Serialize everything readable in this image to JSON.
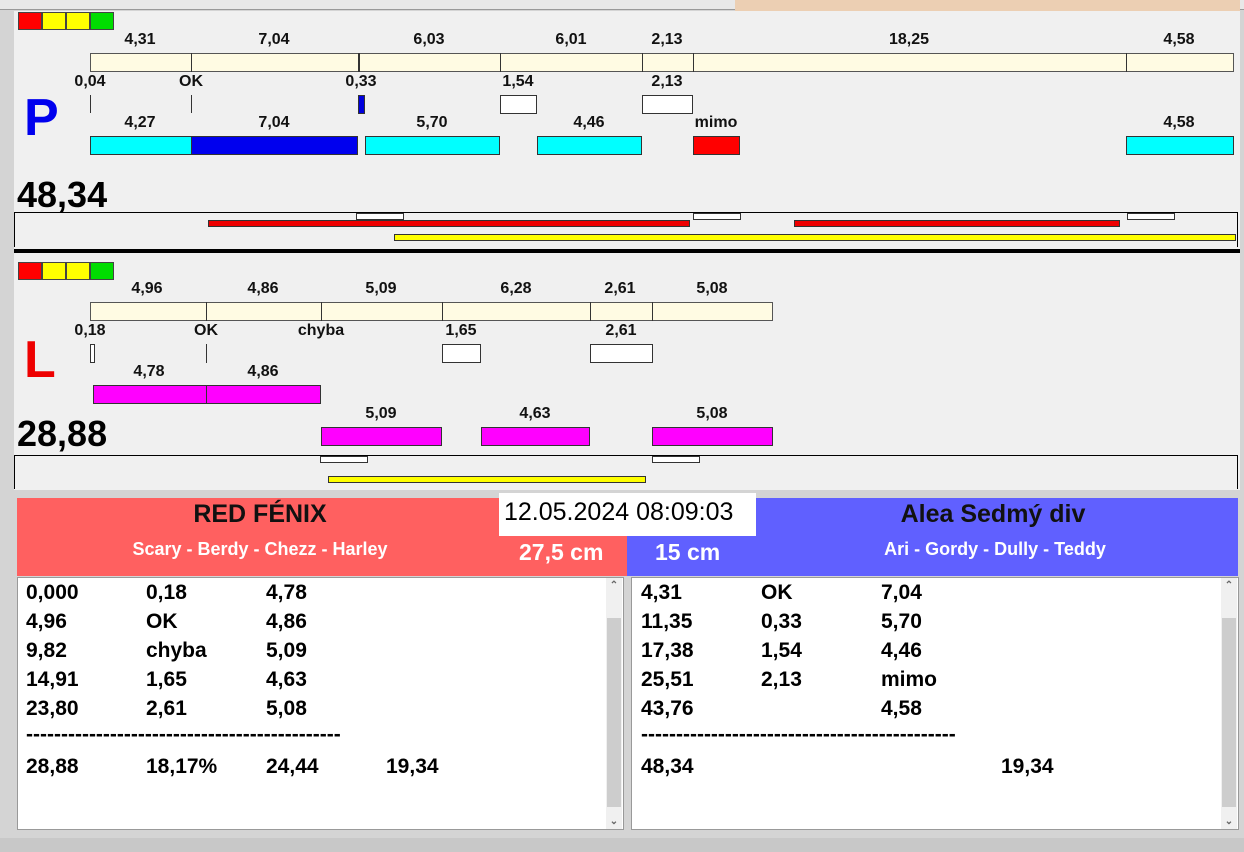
{
  "right_panel": {
    "letter": "P",
    "total": "48,34",
    "top_labels": [
      "4,31",
      "7,04",
      "6,03",
      "6,01",
      "2,13",
      "18,25",
      "4,58"
    ],
    "mid_labels": [
      "0,04",
      "OK",
      "0,33",
      "1,54",
      "2,13"
    ],
    "bottom_labels": [
      "4,27",
      "7,04",
      "5,70",
      "4,46",
      "mimo",
      "4,58"
    ]
  },
  "left_panel": {
    "letter": "L",
    "total": "28,88",
    "top_labels": [
      "4,96",
      "4,86",
      "5,09",
      "6,28",
      "2,61",
      "5,08"
    ],
    "mid_labels": [
      "0,18",
      "OK",
      "chyba",
      "1,65",
      "2,61"
    ],
    "row1_labels": [
      "4,78",
      "4,86"
    ],
    "row2_labels": [
      "5,09",
      "4,63",
      "5,08"
    ]
  },
  "datetime": "12.05.2024 08:09:03",
  "team_left": {
    "name": "RED FÉNIX",
    "members": "Scary - Berdy - Chezz - Harley",
    "height": "27,5 cm",
    "color": "#ff6060",
    "rows": [
      [
        "0,000",
        "0,18",
        "4,78",
        ""
      ],
      [
        "4,96",
        "OK",
        "4,86",
        ""
      ],
      [
        "9,82",
        "chyba",
        "5,09",
        ""
      ],
      [
        "14,91",
        "1,65",
        "4,63",
        ""
      ],
      [
        "23,80",
        "2,61",
        "5,08",
        ""
      ]
    ],
    "separator": "---------------------------------------------",
    "totals": [
      "28,88",
      "18,17%",
      "24,44",
      "19,34"
    ]
  },
  "team_right": {
    "name": "Alea Sedmý div",
    "members": "Ari - Gordy - Dully - Teddy",
    "height": "15 cm",
    "color": "#6060ff",
    "rows": [
      [
        "4,31",
        "OK",
        "7,04",
        ""
      ],
      [
        "11,35",
        "0,33",
        "5,70",
        ""
      ],
      [
        "17,38",
        "1,54",
        "4,46",
        ""
      ],
      [
        "25,51",
        "2,13",
        "mimo",
        ""
      ],
      [
        "43,76",
        "",
        "4,58",
        ""
      ]
    ],
    "separator": "---------------------------------------------",
    "totals": [
      "48,34",
      "",
      "",
      "19,34"
    ]
  }
}
